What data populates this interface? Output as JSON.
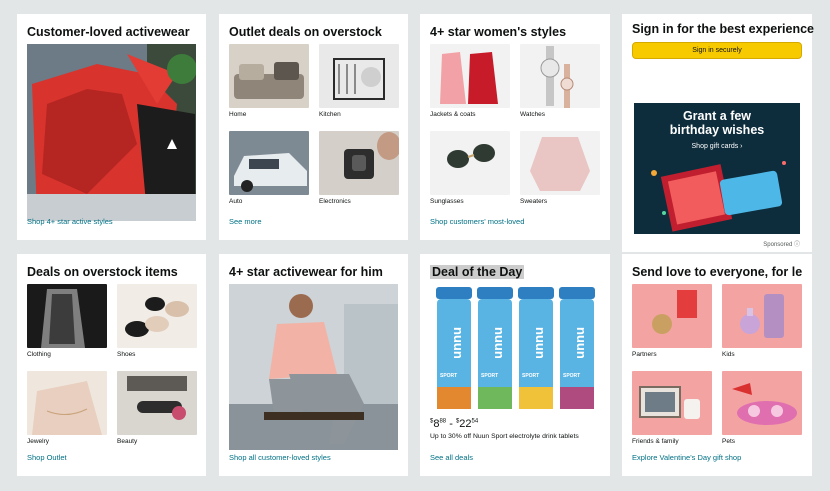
{
  "cards": {
    "c1": {
      "title": "Customer-loved activewear",
      "link": "Shop 4+ star active styles"
    },
    "c2": {
      "title": "Outlet deals on overstock",
      "link": "See more",
      "items": [
        "Home",
        "Kitchen",
        "Auto",
        "Electronics"
      ]
    },
    "c3": {
      "title": "4+ star women's styles",
      "link": "Shop customers' most-loved",
      "items": [
        "Jackets & coats",
        "Watches",
        "Sunglasses",
        "Sweaters"
      ]
    },
    "c5": {
      "title": "Deals on overstock items",
      "link": "Shop Outlet",
      "items": [
        "Clothing",
        "Shoes",
        "Jewelry",
        "Beauty"
      ]
    },
    "c6": {
      "title": "4+ star activewear for him",
      "link": "Shop all customer-loved styles"
    },
    "c7": {
      "title": "Deal of the Day",
      "link": "See all deals",
      "price_low_dollars": "8",
      "price_low_cents": "88",
      "price_sep": "-",
      "price_high_dollars": "22",
      "price_high_cents": "54",
      "description": "Up to 30% off Nuun Sport electrolyte drink tablets",
      "tube_brand": "nuun",
      "tube_variant": "SPORT"
    },
    "c8": {
      "title": "Send love to everyone, for less",
      "link": "Explore Valentine's Day gift shop",
      "items": [
        "Partners",
        "Kids",
        "Friends & family",
        "Pets"
      ]
    }
  },
  "signin": {
    "title": "Sign in for the best experience",
    "button": "Sign in securely"
  },
  "ad": {
    "headline_1": "Grant a few",
    "headline_2": "birthday wishes",
    "cta": "Shop gift cards ›",
    "sponsored": "Sponsored ⓘ"
  },
  "colors": {
    "link": "#007185",
    "button": "#f7ca00",
    "ad_bg": "#0d2d3c",
    "bg": "#e3e6e6"
  },
  "icons": {
    "activewear": "hoodie-photo",
    "info": "info-icon"
  }
}
